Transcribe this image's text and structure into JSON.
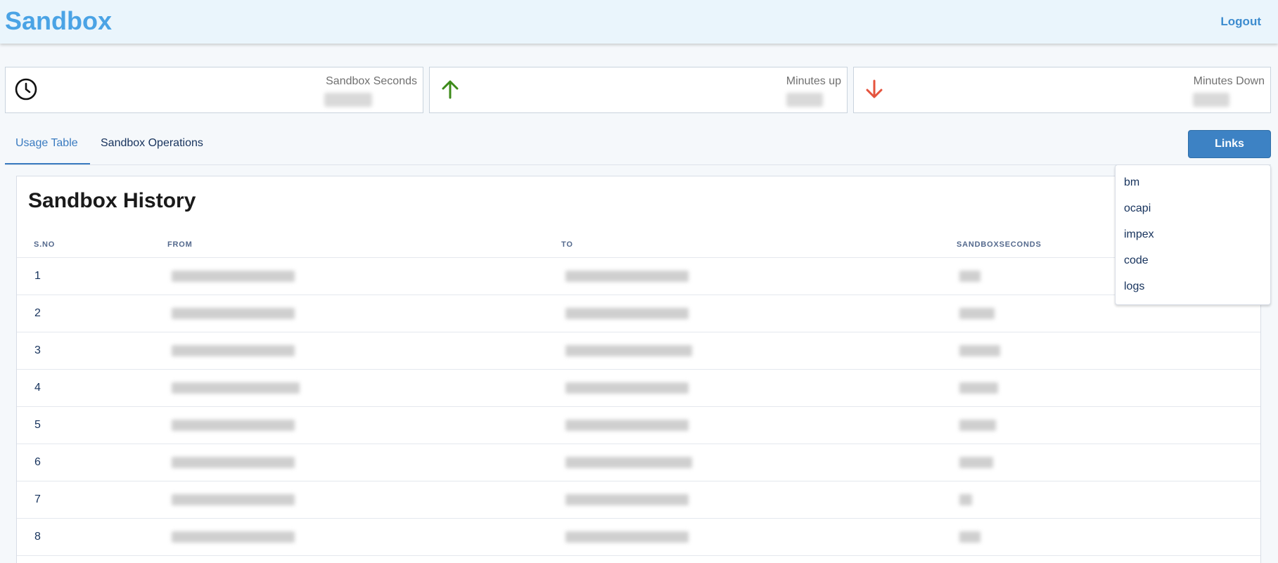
{
  "header": {
    "brand": "Sandbox",
    "logout_label": "Logout"
  },
  "stats": [
    {
      "label": "Sandbox Seconds",
      "icon": "clock-icon",
      "value_hidden": true
    },
    {
      "label": "Minutes up",
      "icon": "arrow-up-icon",
      "icon_color": "#3d8b1a",
      "value_hidden": true
    },
    {
      "label": "Minutes Down",
      "icon": "arrow-down-icon",
      "icon_color": "#e5533d",
      "value_hidden": true
    }
  ],
  "tabs": [
    {
      "label": "Usage Table",
      "active": true
    },
    {
      "label": "Sandbox Operations",
      "active": false
    }
  ],
  "links": {
    "button_label": "Links",
    "items": [
      "bm",
      "ocapi",
      "impex",
      "code",
      "logs"
    ]
  },
  "history": {
    "title": "Sandbox History",
    "columns": [
      "S.NO",
      "FROM",
      "TO",
      "SANDBOXSECONDS"
    ],
    "rows": [
      {
        "sno": "1"
      },
      {
        "sno": "2"
      },
      {
        "sno": "3"
      },
      {
        "sno": "4"
      },
      {
        "sno": "5"
      },
      {
        "sno": "6"
      },
      {
        "sno": "7"
      },
      {
        "sno": "8"
      }
    ]
  },
  "colors": {
    "brand": "#4aa3e5",
    "accent": "#3d82c4",
    "up": "#3d8b1a",
    "down": "#e5533d"
  }
}
